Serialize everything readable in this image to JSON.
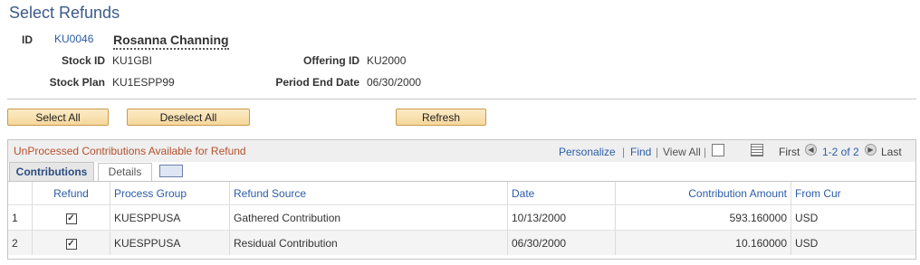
{
  "page": {
    "title": "Select Refunds"
  },
  "header": {
    "id_label": "ID",
    "id_value": "KU0046",
    "name": "Rosanna Channing",
    "stock_id_label": "Stock ID",
    "stock_id_value": "KU1GBI",
    "offering_id_label": "Offering ID",
    "offering_id_value": "KU2000",
    "stock_plan_label": "Stock Plan",
    "stock_plan_value": "KU1ESPP99",
    "period_end_label": "Period End Date",
    "period_end_value": "06/30/2000"
  },
  "buttons": {
    "select_all": "Select All",
    "deselect_all": "Deselect All",
    "refresh": "Refresh"
  },
  "grid": {
    "title": "UnProcessed Contributions Available for Refund",
    "personalize": "Personalize",
    "find": "Find",
    "view_all": "View All",
    "first": "First",
    "range": "1-2 of 2",
    "last": "Last",
    "tabs": [
      "Contributions",
      "Details"
    ],
    "columns": [
      "Refund",
      "Process Group",
      "Refund Source",
      "Date",
      "Contribution Amount",
      "From Cur"
    ],
    "rows": [
      {
        "num": "1",
        "refund": true,
        "process_group": "KUESPPUSA",
        "refund_source": "Gathered Contribution",
        "date": "10/13/2000",
        "amount": "593.160000",
        "currency": "USD"
      },
      {
        "num": "2",
        "refund": true,
        "process_group": "KUESPPUSA",
        "refund_source": "Residual Contribution",
        "date": "06/30/2000",
        "amount": "10.160000",
        "currency": "USD"
      }
    ]
  }
}
